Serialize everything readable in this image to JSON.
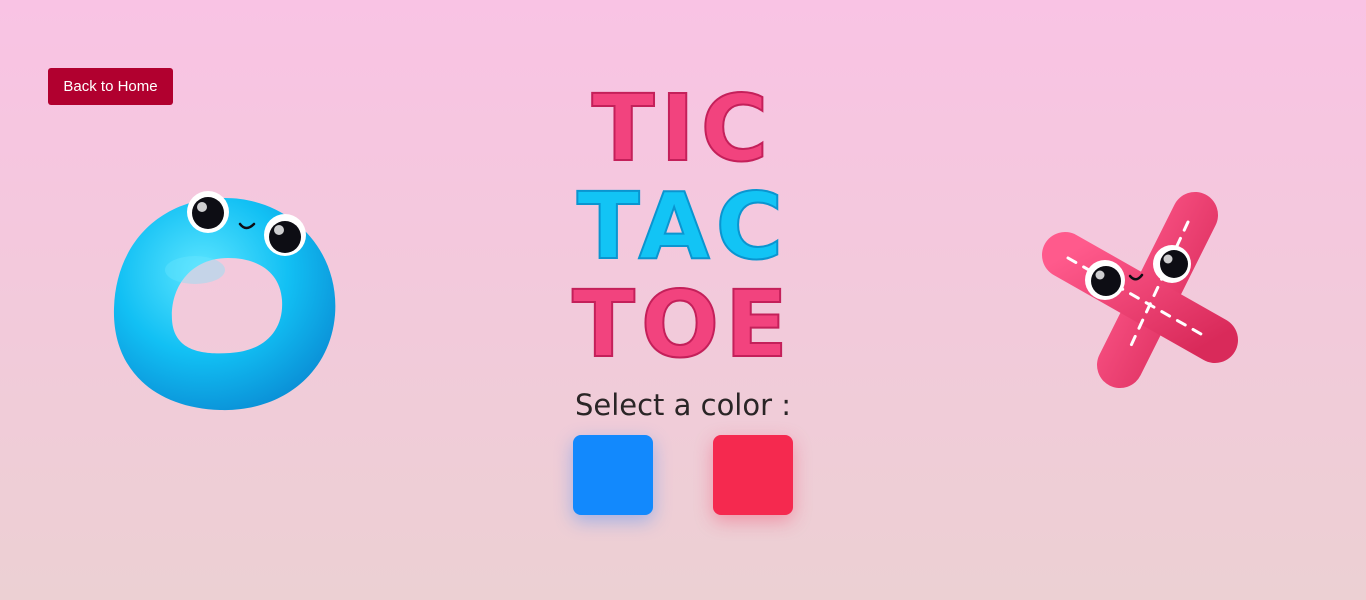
{
  "nav": {
    "back_label": "Back to Home"
  },
  "logo": {
    "line1": "TIC",
    "line2": "TAC",
    "line3": "TOE",
    "colors": {
      "pink": "#f2437e",
      "cyan": "#12c4f5"
    }
  },
  "color_picker": {
    "label": "Select a color :",
    "options": [
      {
        "name": "blue",
        "hex": "#1289fd"
      },
      {
        "name": "red",
        "hex": "#f5294f"
      }
    ]
  },
  "mascots": {
    "left": {
      "icon": "o-mascot-icon",
      "color": "#18c6f7"
    },
    "right": {
      "icon": "x-mascot-icon",
      "color": "#ef3e6f"
    }
  },
  "theme": {
    "background_top": "#f9c3e4",
    "background_bottom": "#ecd0d3",
    "back_button": "#b1002f"
  }
}
